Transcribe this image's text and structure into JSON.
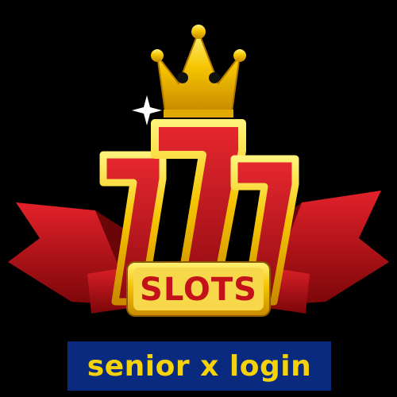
{
  "logo": {
    "word": "SLOTS",
    "digits": [
      "7",
      "7",
      "7"
    ]
  },
  "caption": {
    "text": "senior x login"
  },
  "colors": {
    "background": "#000000",
    "gold": "#f5c400",
    "red": "#c4121a",
    "caption_bg": "#0a2a80",
    "caption_text": "#f5d20a"
  },
  "icons": {
    "crown": "crown-icon",
    "sparkle": "sparkle-icon",
    "ribbon": "ribbon-banner"
  }
}
